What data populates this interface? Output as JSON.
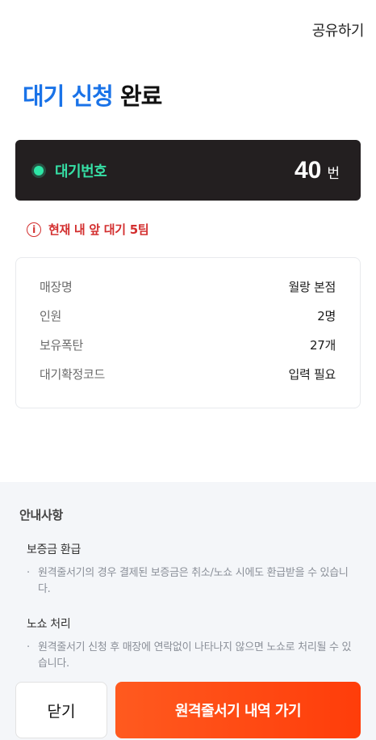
{
  "header": {
    "share_label": "공유하기"
  },
  "title": {
    "highlight": "대기 신청",
    "rest": "완료"
  },
  "ticket": {
    "label": "대기번호",
    "number": "40",
    "unit": "번"
  },
  "notice": {
    "icon": "i",
    "text": "현재 내 앞 대기 5팀"
  },
  "details": {
    "rows": [
      {
        "key": "매장명",
        "value": "월랑 본점"
      },
      {
        "key": "인원",
        "value": "2명"
      },
      {
        "key": "보유폭탄",
        "value": "27개"
      },
      {
        "key": "대기확정코드",
        "value": "입력 필요"
      }
    ]
  },
  "guide": {
    "title": "안내사항",
    "sections": [
      {
        "title": "보증금 환급",
        "text": "원격줄서기의 경우 결제된 보증금은 취소/노쇼 시에도 환급받을 수 있습니다."
      },
      {
        "title": "노쇼 처리",
        "text": "원격줄서기 신청 후 매장에 연락없이 나타나지 않으면 노쇼로 처리될 수 있습니다."
      }
    ]
  },
  "buttons": {
    "close": "닫기",
    "history": "원격줄서기 내역 가기"
  },
  "colors": {
    "accent_blue": "#1a73e8",
    "ticket_bg": "#231f20",
    "ticket_green": "#36e0a6",
    "notice_red": "#d32f2f",
    "cta_orange": "#ff4a14"
  }
}
